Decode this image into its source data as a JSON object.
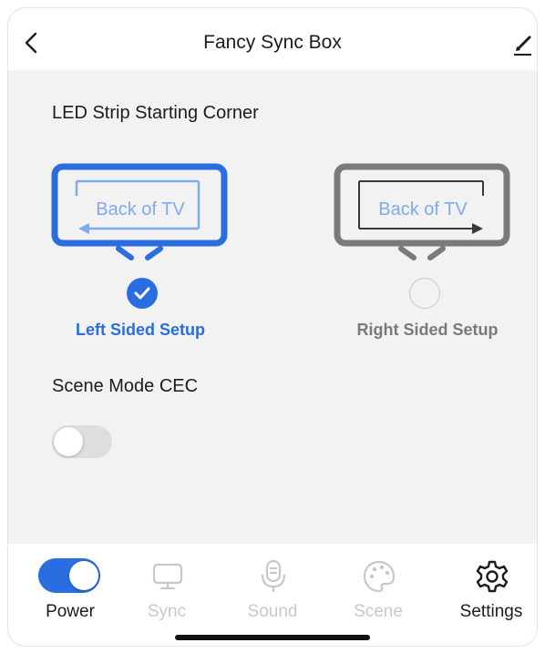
{
  "header": {
    "title": "Fancy Sync Box",
    "back_icon": "chevron-left-icon",
    "edit_icon": "pencil-icon"
  },
  "led_section": {
    "heading": "LED Strip Starting Corner",
    "options": [
      {
        "tv_text": "Back of TV",
        "label": "Left Sided Setup",
        "selected": true,
        "color": "#2a6de0"
      },
      {
        "tv_text": "Back of TV",
        "label": "Right Sided Setup",
        "selected": false,
        "color": "#7a7a7a"
      }
    ]
  },
  "cec_section": {
    "heading": "Scene Mode CEC",
    "toggle_on": false
  },
  "tabbar": {
    "items": [
      {
        "label": "Power",
        "icon": "toggle-icon",
        "enabled": true
      },
      {
        "label": "Sync",
        "icon": "monitor-icon",
        "enabled": false
      },
      {
        "label": "Sound",
        "icon": "microphone-icon",
        "enabled": false
      },
      {
        "label": "Scene",
        "icon": "palette-icon",
        "enabled": false
      },
      {
        "label": "Settings",
        "icon": "gear-icon",
        "enabled": true
      }
    ],
    "power_on": true
  },
  "colors": {
    "accent": "#2a6de0",
    "background": "#f2f2f2",
    "inactive": "#c8c8c8"
  }
}
